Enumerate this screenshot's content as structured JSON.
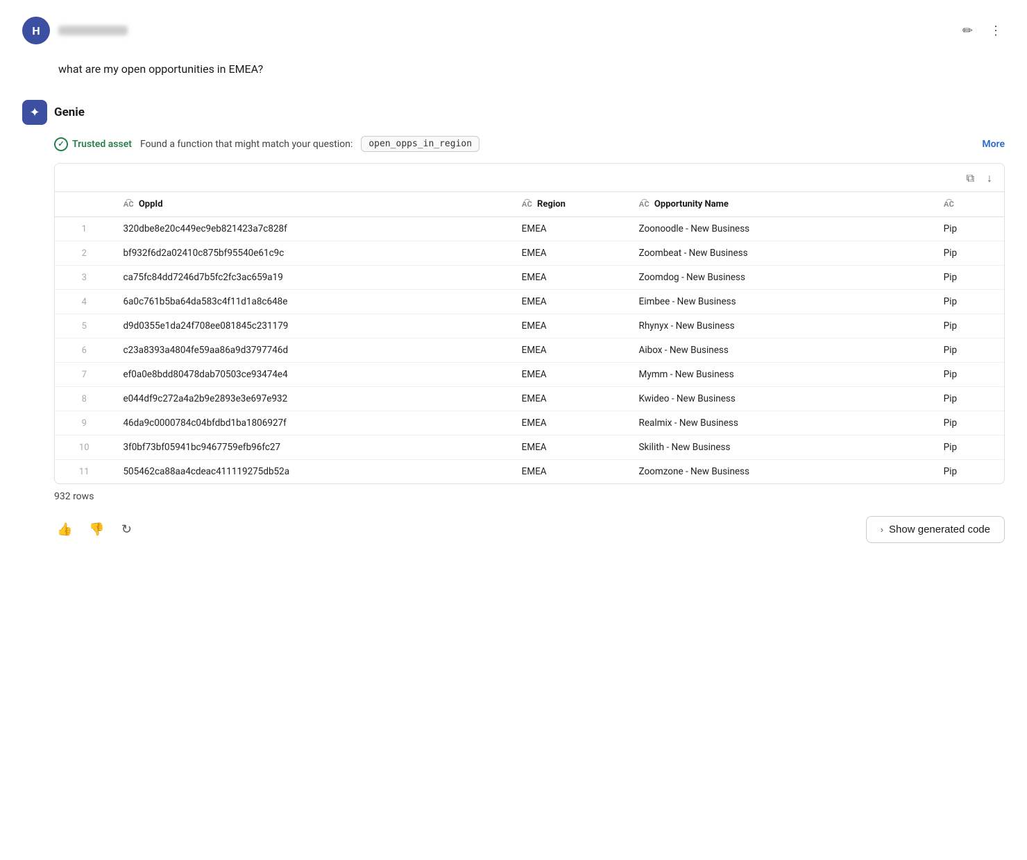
{
  "header": {
    "avatar_letter": "H",
    "edit_icon": "✏",
    "more_icon": "⋮"
  },
  "conversation": {
    "user_question": "what are my open opportunities in EMEA?"
  },
  "genie": {
    "label": "Genie",
    "icon": "✦",
    "trusted_asset_label": "Trusted asset",
    "found_text": "Found a function that might match your question:",
    "function_name": "open_opps_in_region",
    "more_label": "More"
  },
  "table": {
    "copy_icon": "⧉",
    "download_icon": "↓",
    "columns": [
      {
        "id": "oppid",
        "label": "OppId",
        "type": "ABC"
      },
      {
        "id": "region",
        "label": "Region",
        "type": "ABC"
      },
      {
        "id": "oppname",
        "label": "Opportunity Name",
        "type": "ABC"
      },
      {
        "id": "extra",
        "label": "",
        "type": "ABC"
      }
    ],
    "rows": [
      {
        "num": 1,
        "oppid": "320dbe8e20c449ec9eb821423a7c828f",
        "region": "EMEA",
        "oppname": "Zoonoodle - New Business",
        "extra": "Pip"
      },
      {
        "num": 2,
        "oppid": "bf932f6d2a02410c875bf95540e61c9c",
        "region": "EMEA",
        "oppname": "Zoombeat - New Business",
        "extra": "Pip"
      },
      {
        "num": 3,
        "oppid": "ca75fc84dd7246d7b5fc2fc3ac659a19",
        "region": "EMEA",
        "oppname": "Zoomdog - New Business",
        "extra": "Pip"
      },
      {
        "num": 4,
        "oppid": "6a0c761b5ba64da583c4f11d1a8c648e",
        "region": "EMEA",
        "oppname": "Eimbee - New Business",
        "extra": "Pip"
      },
      {
        "num": 5,
        "oppid": "d9d0355e1da24f708ee081845c231179",
        "region": "EMEA",
        "oppname": "Rhynyx - New Business",
        "extra": "Pip"
      },
      {
        "num": 6,
        "oppid": "c23a8393a4804fe59aa86a9d3797746d",
        "region": "EMEA",
        "oppname": "Aibox - New Business",
        "extra": "Pip"
      },
      {
        "num": 7,
        "oppid": "ef0a0e8bdd80478dab70503ce93474e4",
        "region": "EMEA",
        "oppname": "Mymm - New Business",
        "extra": "Pip"
      },
      {
        "num": 8,
        "oppid": "e044df9c272a4a2b9e2893e3e697e932",
        "region": "EMEA",
        "oppname": "Kwideo - New Business",
        "extra": "Pip"
      },
      {
        "num": 9,
        "oppid": "46da9c0000784c04bfdbd1ba1806927f",
        "region": "EMEA",
        "oppname": "Realmix - New Business",
        "extra": "Pip"
      },
      {
        "num": 10,
        "oppid": "3f0bf73bf05941bc9467759efb96fc27",
        "region": "EMEA",
        "oppname": "Skilith - New Business",
        "extra": "Pip"
      },
      {
        "num": 11,
        "oppid": "505462ca88aa4cdeac411119275db52a",
        "region": "EMEA",
        "oppname": "Zoomzone - New Business",
        "extra": "Pip"
      }
    ],
    "row_count": "932 rows"
  },
  "footer": {
    "thumbs_up": "👍",
    "thumbs_down": "👎",
    "refresh": "↻",
    "show_code_chevron": "›",
    "show_code_label": "Show generated code"
  }
}
